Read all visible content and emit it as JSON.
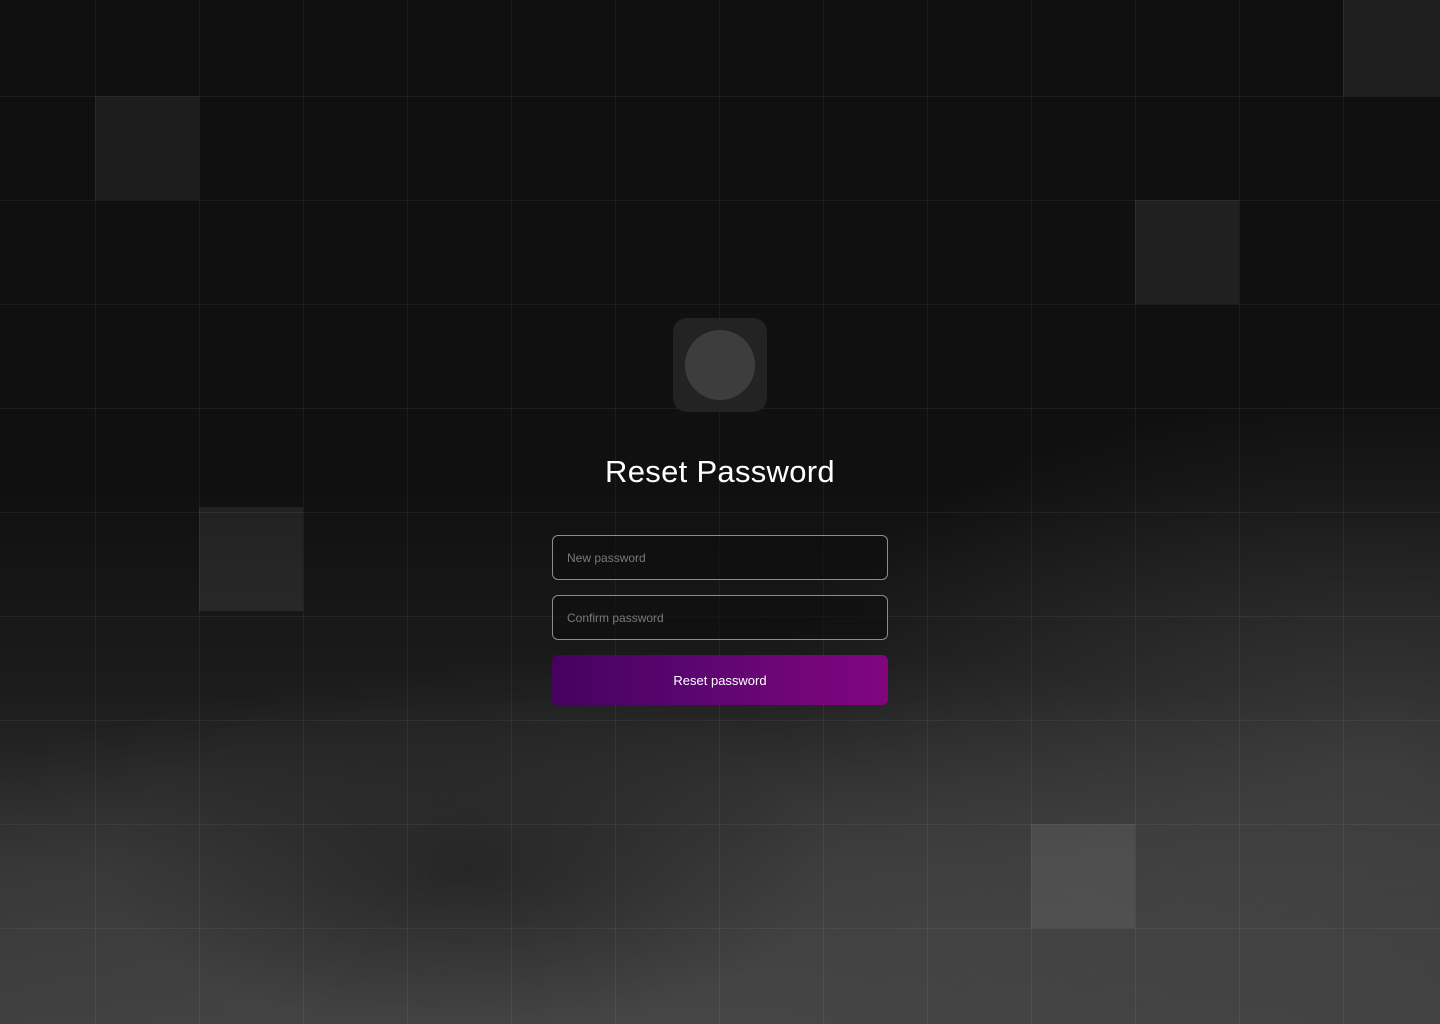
{
  "logo": {
    "icon": "circle-logo-icon"
  },
  "page": {
    "title": "Reset Password"
  },
  "form": {
    "new_password_placeholder": "New password",
    "confirm_password_placeholder": "Confirm password",
    "submit_label": "Reset password"
  },
  "colors": {
    "background": "#0e0e0e",
    "button_gradient_start": "#45025f",
    "button_gradient_end": "#82057f",
    "field_border": "#8c8c8c"
  }
}
